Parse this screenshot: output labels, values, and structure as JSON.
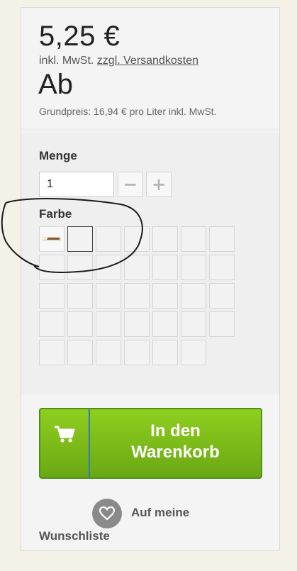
{
  "price": {
    "amount": "5,25 €",
    "tax_prefix": "inkl. MwSt.",
    "shipping_link": "zzgl. Versandkosten",
    "from_label": "Ab",
    "unit_price": "Grundpreis: 16,94 € pro Liter inkl. MwSt."
  },
  "quantity": {
    "label": "Menge",
    "value": "1",
    "decrement": "−",
    "increment": "+"
  },
  "color": {
    "label": "Farbe",
    "swatch_count": 34,
    "selected_index": 1
  },
  "cart_button": {
    "icon": "shopping-cart-icon",
    "line1": "In den",
    "line2": "Warenkorb",
    "accent": "#7dbf1a"
  },
  "wishlist": {
    "icon": "heart-icon",
    "line1": "Auf meine",
    "line2": "Wunschliste"
  }
}
